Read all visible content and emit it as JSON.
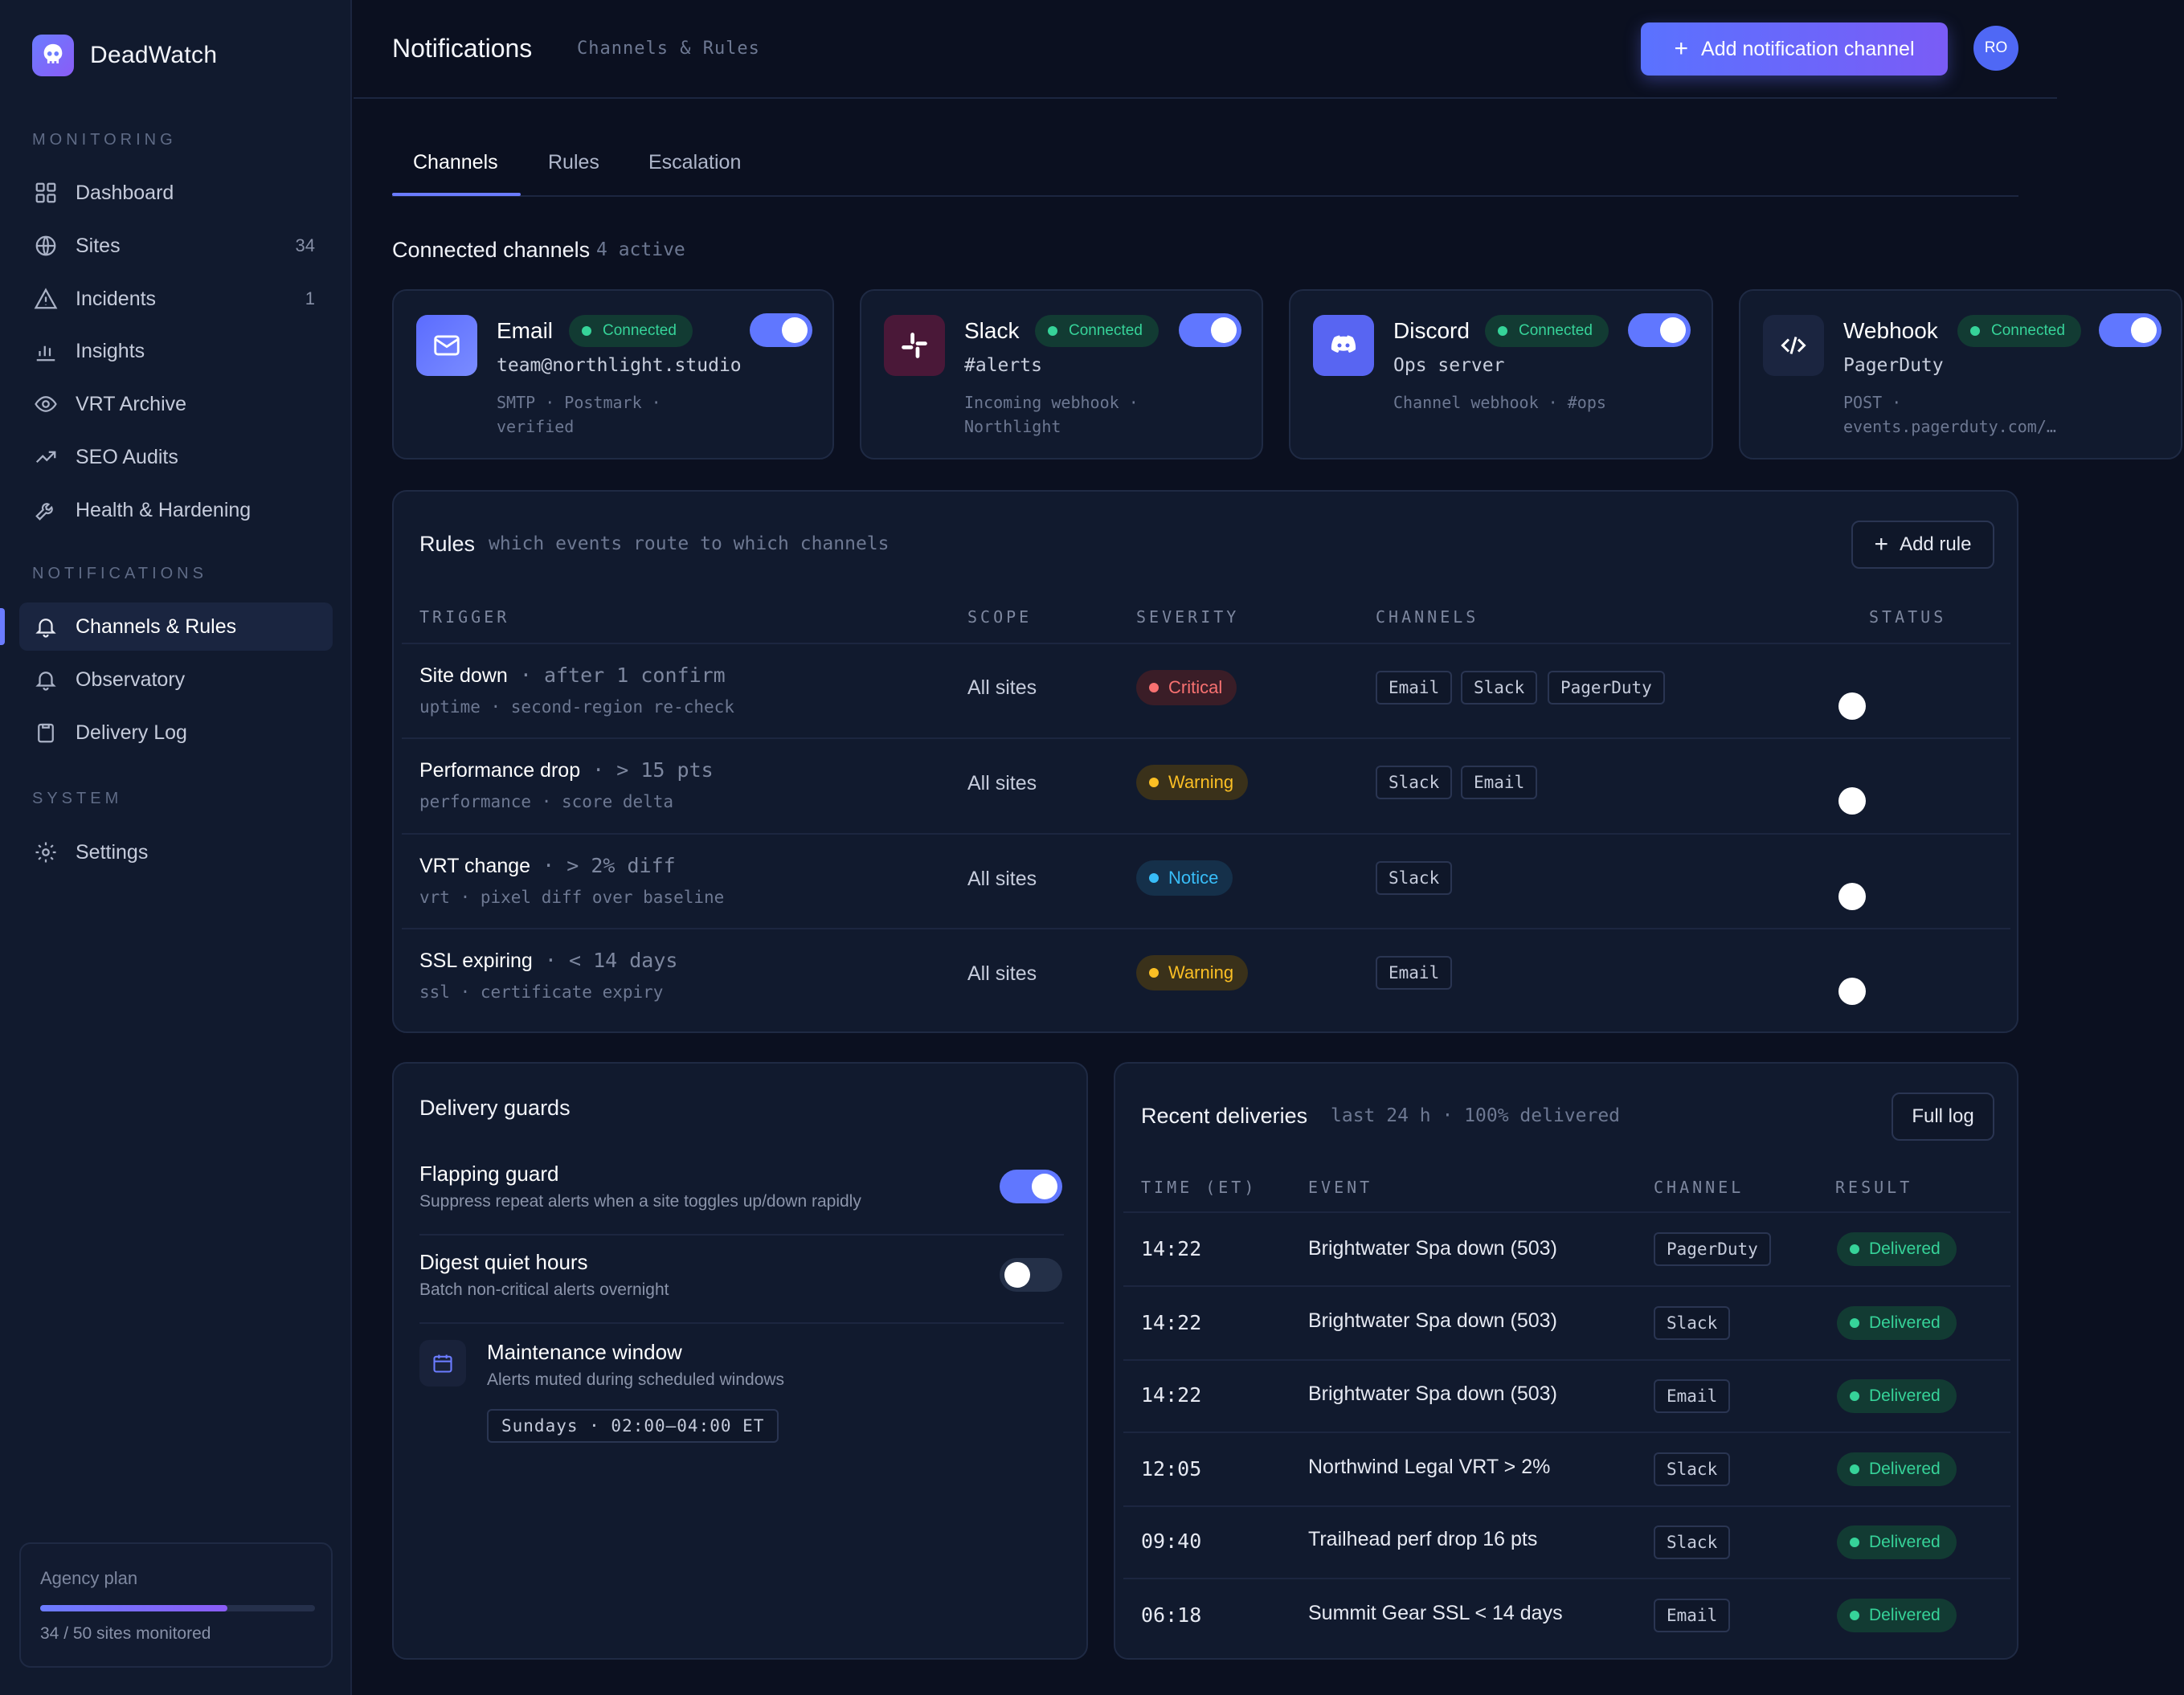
{
  "app": {
    "name": "DeadWatch",
    "logo_icon": "skull-icon",
    "accent": "#6b7cff"
  },
  "sidebar": {
    "sections": [
      {
        "label": "MONITORING"
      },
      {
        "label": "NOTIFICATIONS"
      },
      {
        "label": "SYSTEM"
      }
    ],
    "items": [
      {
        "label": "Dashboard",
        "icon": "grid-icon",
        "count": ""
      },
      {
        "label": "Sites",
        "icon": "globe-icon",
        "count": "34"
      },
      {
        "label": "Incidents",
        "icon": "warning-icon",
        "count": "1"
      },
      {
        "label": "Insights",
        "icon": "bar-chart-icon",
        "count": ""
      },
      {
        "label": "VRT Archive",
        "icon": "eye-icon",
        "count": ""
      },
      {
        "label": "SEO Audits",
        "icon": "trend-icon",
        "count": ""
      },
      {
        "label": "Health & Hardening",
        "icon": "wrench-icon",
        "count": ""
      },
      {
        "label": "Channels & Rules",
        "icon": "bell-icon",
        "count": "",
        "active": true
      },
      {
        "label": "Observatory",
        "icon": "bell-outline-icon",
        "count": ""
      },
      {
        "label": "Delivery Log",
        "icon": "clipboard-icon",
        "count": ""
      },
      {
        "label": "Settings",
        "icon": "gear-icon",
        "count": ""
      }
    ],
    "plan": {
      "title": "Agency plan",
      "usage": "34 / 50 sites monitored",
      "fraction": 0.68
    }
  },
  "header": {
    "title": "Notifications",
    "subtitle": "Channels & Rules",
    "add_button": "Add notification channel",
    "avatar": "RO"
  },
  "tabs": [
    {
      "label": "Channels",
      "active": true
    },
    {
      "label": "Rules"
    },
    {
      "label": "Escalation"
    }
  ],
  "channels_section": {
    "title": "Connected channels",
    "meta": "4 active"
  },
  "channels": [
    {
      "name": "Email",
      "status": "Connected",
      "detail": "team@northlight.studio",
      "meta1": "SMTP · Postmark ·",
      "meta2": "verified",
      "enabled": true,
      "icon": "mail-icon",
      "color": "#5b6cff"
    },
    {
      "name": "Slack",
      "status": "Connected",
      "detail": "#alerts",
      "meta1": "Incoming webhook ·",
      "meta2": "Northlight",
      "enabled": true,
      "icon": "slack-icon",
      "color": "#4a1838"
    },
    {
      "name": "Discord",
      "status": "Connected",
      "detail": "Ops server",
      "meta1": "Channel webhook · #ops",
      "meta2": "",
      "enabled": true,
      "icon": "discord-icon",
      "color": "#5865f2"
    },
    {
      "name": "Webhook",
      "status": "Connected",
      "detail": "PagerDuty",
      "meta1": "POST ·",
      "meta2": "events.pagerduty.com/…",
      "enabled": true,
      "icon": "code-icon",
      "color": "#1b2540"
    }
  ],
  "rules": {
    "title": "Rules",
    "meta": "which events route to which channels",
    "add_button": "Add rule",
    "columns": [
      "TRIGGER",
      "SCOPE",
      "SEVERITY",
      "CHANNELS",
      "STATUS"
    ],
    "rows": [
      {
        "trigger": "Site down",
        "cond": "after 1 confirm",
        "sub": "uptime · second-region re-check",
        "scope": "All sites",
        "severity": "Critical",
        "sev_color": "#f87171",
        "sev_bg": "#3a1d27",
        "channels": [
          "Email",
          "Slack",
          "PagerDuty"
        ]
      },
      {
        "trigger": "Performance drop",
        "cond": "> 15 pts",
        "sub": "performance · score delta",
        "scope": "All sites",
        "severity": "Warning",
        "sev_color": "#fbbf24",
        "sev_bg": "#3a311a",
        "channels": [
          "Slack",
          "Email"
        ]
      },
      {
        "trigger": "VRT change",
        "cond": "> 2% diff",
        "sub": "vrt · pixel diff over baseline",
        "scope": "All sites",
        "severity": "Notice",
        "sev_color": "#38bdf8",
        "sev_bg": "#15304a",
        "channels": [
          "Slack"
        ]
      },
      {
        "trigger": "SSL expiring",
        "cond": "< 14 days",
        "sub": "ssl · certificate expiry",
        "scope": "All sites",
        "severity": "Warning",
        "sev_color": "#fbbf24",
        "sev_bg": "#3a311a",
        "channels": [
          "Email"
        ]
      }
    ]
  },
  "guards": {
    "title": "Delivery guards",
    "items": [
      {
        "title": "Flapping guard",
        "sub": "Suppress repeat alerts when a site toggles up/down rapidly",
        "enabled": true
      },
      {
        "title": "Digest quiet hours",
        "sub": "Batch non-critical alerts overnight",
        "enabled": false
      }
    ],
    "maintenance": {
      "title": "Maintenance window",
      "sub": "Alerts muted during scheduled windows",
      "window": "Sundays · 02:00–04:00 ET"
    }
  },
  "deliveries": {
    "title": "Recent deliveries",
    "meta": "last 24 h · 100% delivered",
    "button": "Full log",
    "columns": [
      "TIME (ET)",
      "EVENT",
      "CHANNEL",
      "RESULT"
    ],
    "rows": [
      {
        "time": "14:22",
        "event": "Brightwater Spa down (503)",
        "channel": "PagerDuty",
        "result": "Delivered"
      },
      {
        "time": "14:22",
        "event": "Brightwater Spa down (503)",
        "channel": "Slack",
        "result": "Delivered"
      },
      {
        "time": "14:22",
        "event": "Brightwater Spa down (503)",
        "channel": "Email",
        "result": "Delivered"
      },
      {
        "time": "12:05",
        "event": "Northwind Legal VRT > 2%",
        "channel": "Slack",
        "result": "Delivered"
      },
      {
        "time": "09:40",
        "event": "Trailhead perf drop 16 pts",
        "channel": "Slack",
        "result": "Delivered"
      },
      {
        "time": "06:18",
        "event": "Summit Gear SSL < 14 days",
        "channel": "Email",
        "result": "Delivered"
      }
    ]
  }
}
